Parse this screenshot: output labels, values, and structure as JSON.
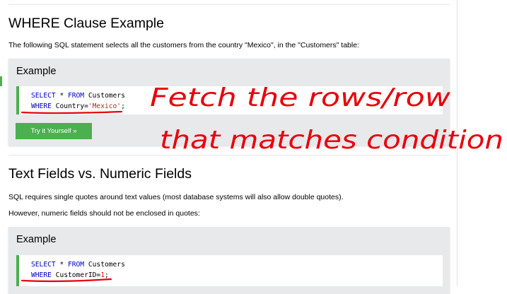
{
  "section1": {
    "title": "WHERE Clause Example",
    "description": "The following SQL statement selects all the customers from the country \"Mexico\", in the \"Customers\" table:"
  },
  "example1": {
    "heading": "Example",
    "code_line1": {
      "kw1": "SELECT",
      "mid": " * ",
      "kw2": "FROM",
      "rest": " Customers"
    },
    "code_line2": {
      "kw": "WHERE",
      "mid": " Country=",
      "str": "'Mexico'",
      "end": ";"
    },
    "button_label": "Try it Yourself »"
  },
  "section2": {
    "title": "Text Fields vs. Numeric Fields",
    "para1": "SQL requires single quotes around text values (most database systems will also allow double quotes).",
    "para2": "However, numeric fields should not be enclosed in quotes:"
  },
  "example2": {
    "heading": "Example",
    "code_line1": {
      "kw1": "SELECT",
      "mid": " * ",
      "kw2": "FROM",
      "rest": " Customers"
    },
    "code_line2": {
      "kw": "WHERE",
      "mid": " CustomerID=",
      "num": "1",
      "end": ";"
    }
  },
  "handwriting": {
    "line1": "Fetch the rows/row",
    "line2": "that matches condition"
  },
  "colors": {
    "accent_green": "#4CAF50",
    "ink_red": "#e8000b",
    "keyword_blue": "#0000cd",
    "string_brown": "#a52a2a",
    "number_red": "#ff0000"
  }
}
